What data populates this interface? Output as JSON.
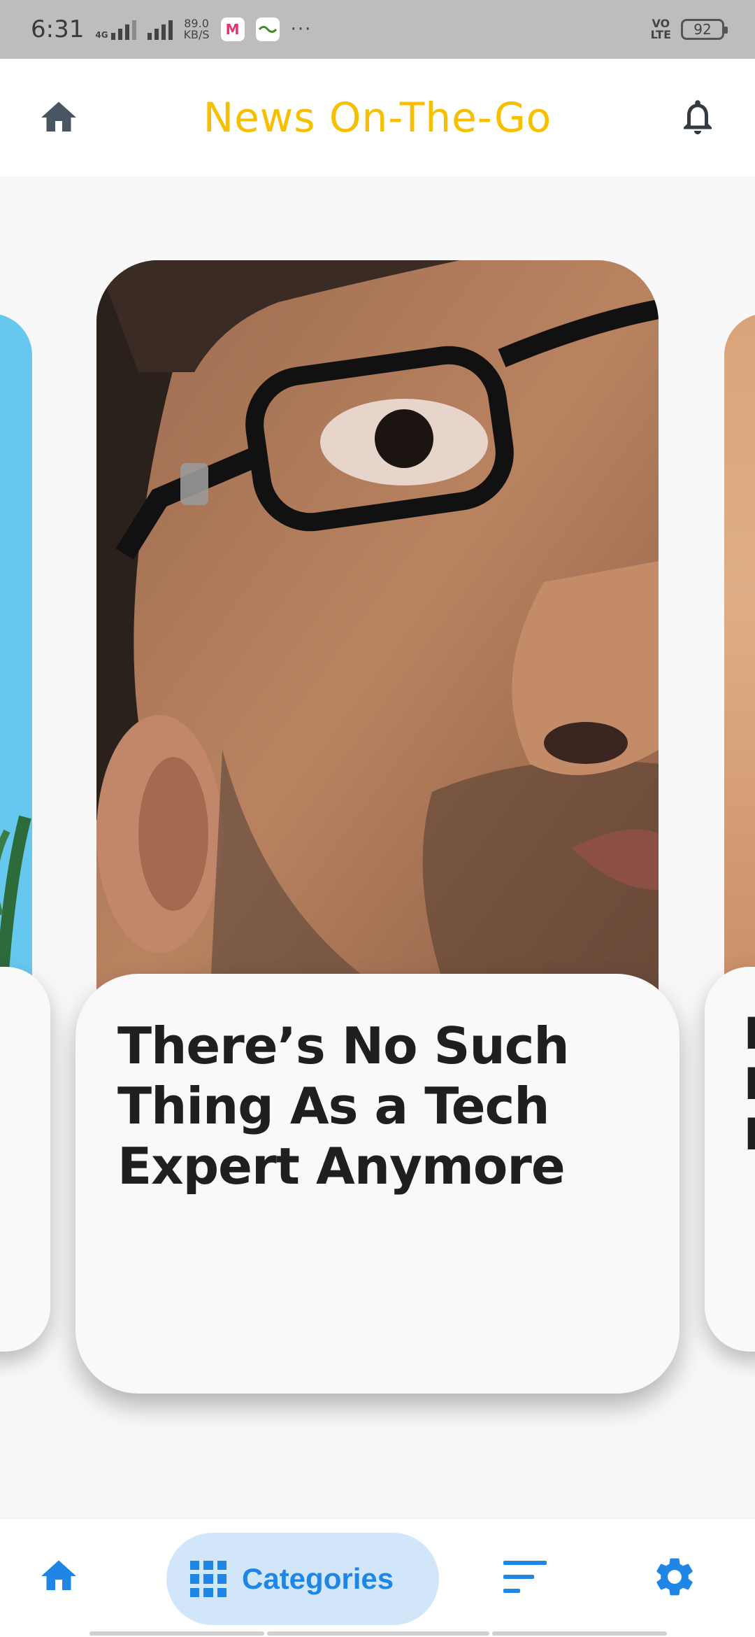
{
  "status_bar": {
    "time": "6:31",
    "network_type": "4G",
    "net_speed_value": "89.0",
    "net_speed_unit": "KB/S",
    "app_badge_1": "M",
    "overflow": "···",
    "volte_top": "VO",
    "volte_bottom": "LTE",
    "battery": "92"
  },
  "app_bar": {
    "title": "News On-The-Go",
    "left_icon": "home-icon",
    "right_icon": "bell-icon",
    "title_color": "#f6c000"
  },
  "carousel": {
    "main_card": {
      "headline": "There’s No Such Thing As a Tech Expert Anymore"
    },
    "right_peek": {
      "letters": [
        "H",
        "D",
        "H"
      ]
    }
  },
  "bottom_nav": {
    "items": [
      {
        "icon": "home-icon"
      },
      {
        "icon": "grid-icon",
        "label": "Categories",
        "selected": true
      },
      {
        "icon": "sort-icon"
      },
      {
        "icon": "gear-icon"
      }
    ],
    "accent": "#1f86e6",
    "selected_bg": "#d2e6fa"
  }
}
